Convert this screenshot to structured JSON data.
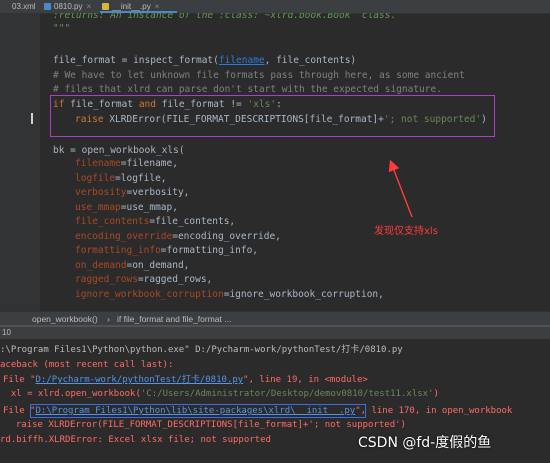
{
  "tabs": [
    {
      "label": "03.xml",
      "icon": "xml-file-icon",
      "active": false
    },
    {
      "label": "0810.py",
      "icon": "python-file-icon",
      "active": false
    },
    {
      "label": "__init__.py",
      "icon": "python-file-icon",
      "active": true
    }
  ],
  "code": {
    "l0_a": ":returns: An instance of the :class:`~xlrd.book.Book` class.",
    "l1_a": "\"\"\"",
    "l3_a": "file_format = inspect_format(",
    "l3_b": "filename",
    "l3_c": ", file_contents)",
    "l4_a": "# We have to let unknown file formats pass through here, as some ancient",
    "l5_a": "# files that xlrd can parse don't start with the expected signature.",
    "l6_kw1": "if ",
    "l6_a": "file_format ",
    "l6_kw2": "and ",
    "l6_b": "file_format != ",
    "l6_str": "'xls'",
    "l6_c": ":",
    "l7_kw": "raise ",
    "l7_a": "XLRDError(FILE_FORMAT_DESCRIPTIONS[file_format]+",
    "l7_str": "'; not supported'",
    "l7_b": ")",
    "l9_a": "bk = open_workbook_xls(",
    "args": [
      {
        "p": "filename",
        "v": "=filename,"
      },
      {
        "p": "logfile",
        "v": "=logfile,"
      },
      {
        "p": "verbosity",
        "v": "=verbosity,"
      },
      {
        "p": "use_mmap",
        "v": "=use_mmap,"
      },
      {
        "p": "file_contents",
        "v": "=file_contents,"
      },
      {
        "p": "encoding_override",
        "v": "=encoding_override,"
      },
      {
        "p": "formatting_info",
        "v": "=formatting_info,"
      },
      {
        "p": "on_demand",
        "v": "=on_demand,"
      },
      {
        "p": "ragged_rows",
        "v": "=ragged_rows,"
      },
      {
        "p": "ignore_workbook_corruption",
        "v": "=ignore_workbook_corruption,"
      }
    ]
  },
  "annotation": "发现仅支持xls",
  "breadcrumb": {
    "item1": "open_workbook()",
    "sep": "›",
    "item2": "if file_format and file_format ..."
  },
  "runbar": {
    "label": "10"
  },
  "console": {
    "c0": ":\\Program Files1\\Python\\python.exe\" D:/Pycharm-work/pythonTest/打卡/0810.py",
    "c1": "aceback (most recent call last):",
    "c2_a": "File \"",
    "c2_link": "D:/Pycharm-work/pythonTest/打卡/0810.py",
    "c2_b": "\", line 19, in <module>",
    "c3_a": "  xl = xlrd.open_workbook(",
    "c3_str": "'C:/Users/Administrator/Desktop/demov0810/test11.xlsx'",
    "c3_b": ")",
    "c4_a": "File \"",
    "c4_link": "D:\\Program Files1\\Python\\lib\\site-packages\\xlrd\\__init__.py",
    "c4_b": "\", line 170, in open_workbook",
    "c5_a": "  raise XLRDError(FILE_FORMAT_DESCRIPTIONS[file_format]+'; not supported')",
    "c6_a": "rd.biffh.XLRDError: Excel xlsx file; not supported"
  },
  "watermark": "CSDN @fd-度假的鱼",
  "colors": {
    "highlight_box": "#b03bc6",
    "link_box": "#3a6ee8",
    "annotation": "#ff3b3b"
  }
}
